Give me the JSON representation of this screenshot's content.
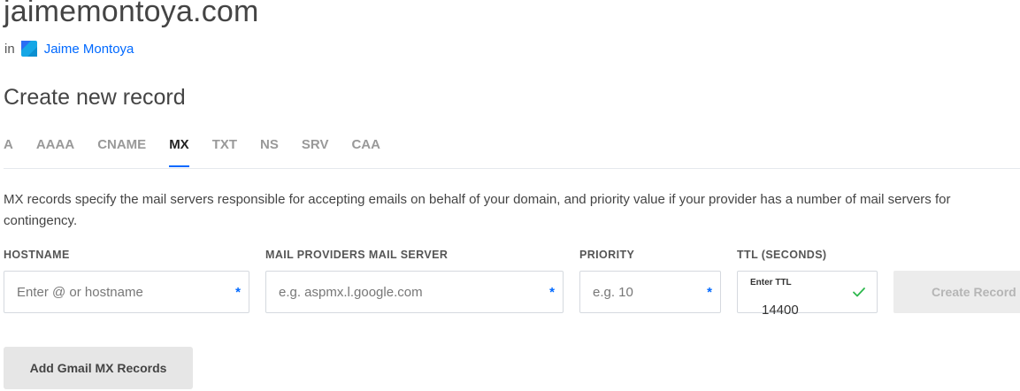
{
  "header": {
    "domain": "jaimemontoya.com",
    "project_prefix": "in",
    "project_name": "Jaime Montoya",
    "project_icon": "project-icon"
  },
  "section": {
    "title": "Create new record"
  },
  "tabs": [
    {
      "label": "A",
      "active": false
    },
    {
      "label": "AAAA",
      "active": false
    },
    {
      "label": "CNAME",
      "active": false
    },
    {
      "label": "MX",
      "active": true
    },
    {
      "label": "TXT",
      "active": false
    },
    {
      "label": "NS",
      "active": false
    },
    {
      "label": "SRV",
      "active": false
    },
    {
      "label": "CAA",
      "active": false
    }
  ],
  "description": "MX records specify the mail servers responsible for accepting emails on behalf of your domain, and priority value if your provider has a number of mail servers for contingency.",
  "form": {
    "hostname": {
      "label": "HOSTNAME",
      "placeholder": "Enter @ or hostname",
      "value": "",
      "required_mark": "*"
    },
    "mail_server": {
      "label": "MAIL PROVIDERS MAIL SERVER",
      "placeholder": "e.g. aspmx.l.google.com",
      "value": "",
      "required_mark": "*"
    },
    "priority": {
      "label": "PRIORITY",
      "placeholder": "e.g. 10",
      "value": "",
      "required_mark": "*"
    },
    "ttl": {
      "label": "TTL (SECONDS)",
      "small_label": "Enter TTL",
      "value": "14400",
      "valid_icon": "check-icon"
    },
    "create_button": "Create Record"
  },
  "gmail_button": "Add Gmail MX Records",
  "colors": {
    "accent": "#0069ff",
    "valid": "#2db84d",
    "disabled_bg": "#ececec",
    "disabled_text": "#b5b5b5"
  }
}
